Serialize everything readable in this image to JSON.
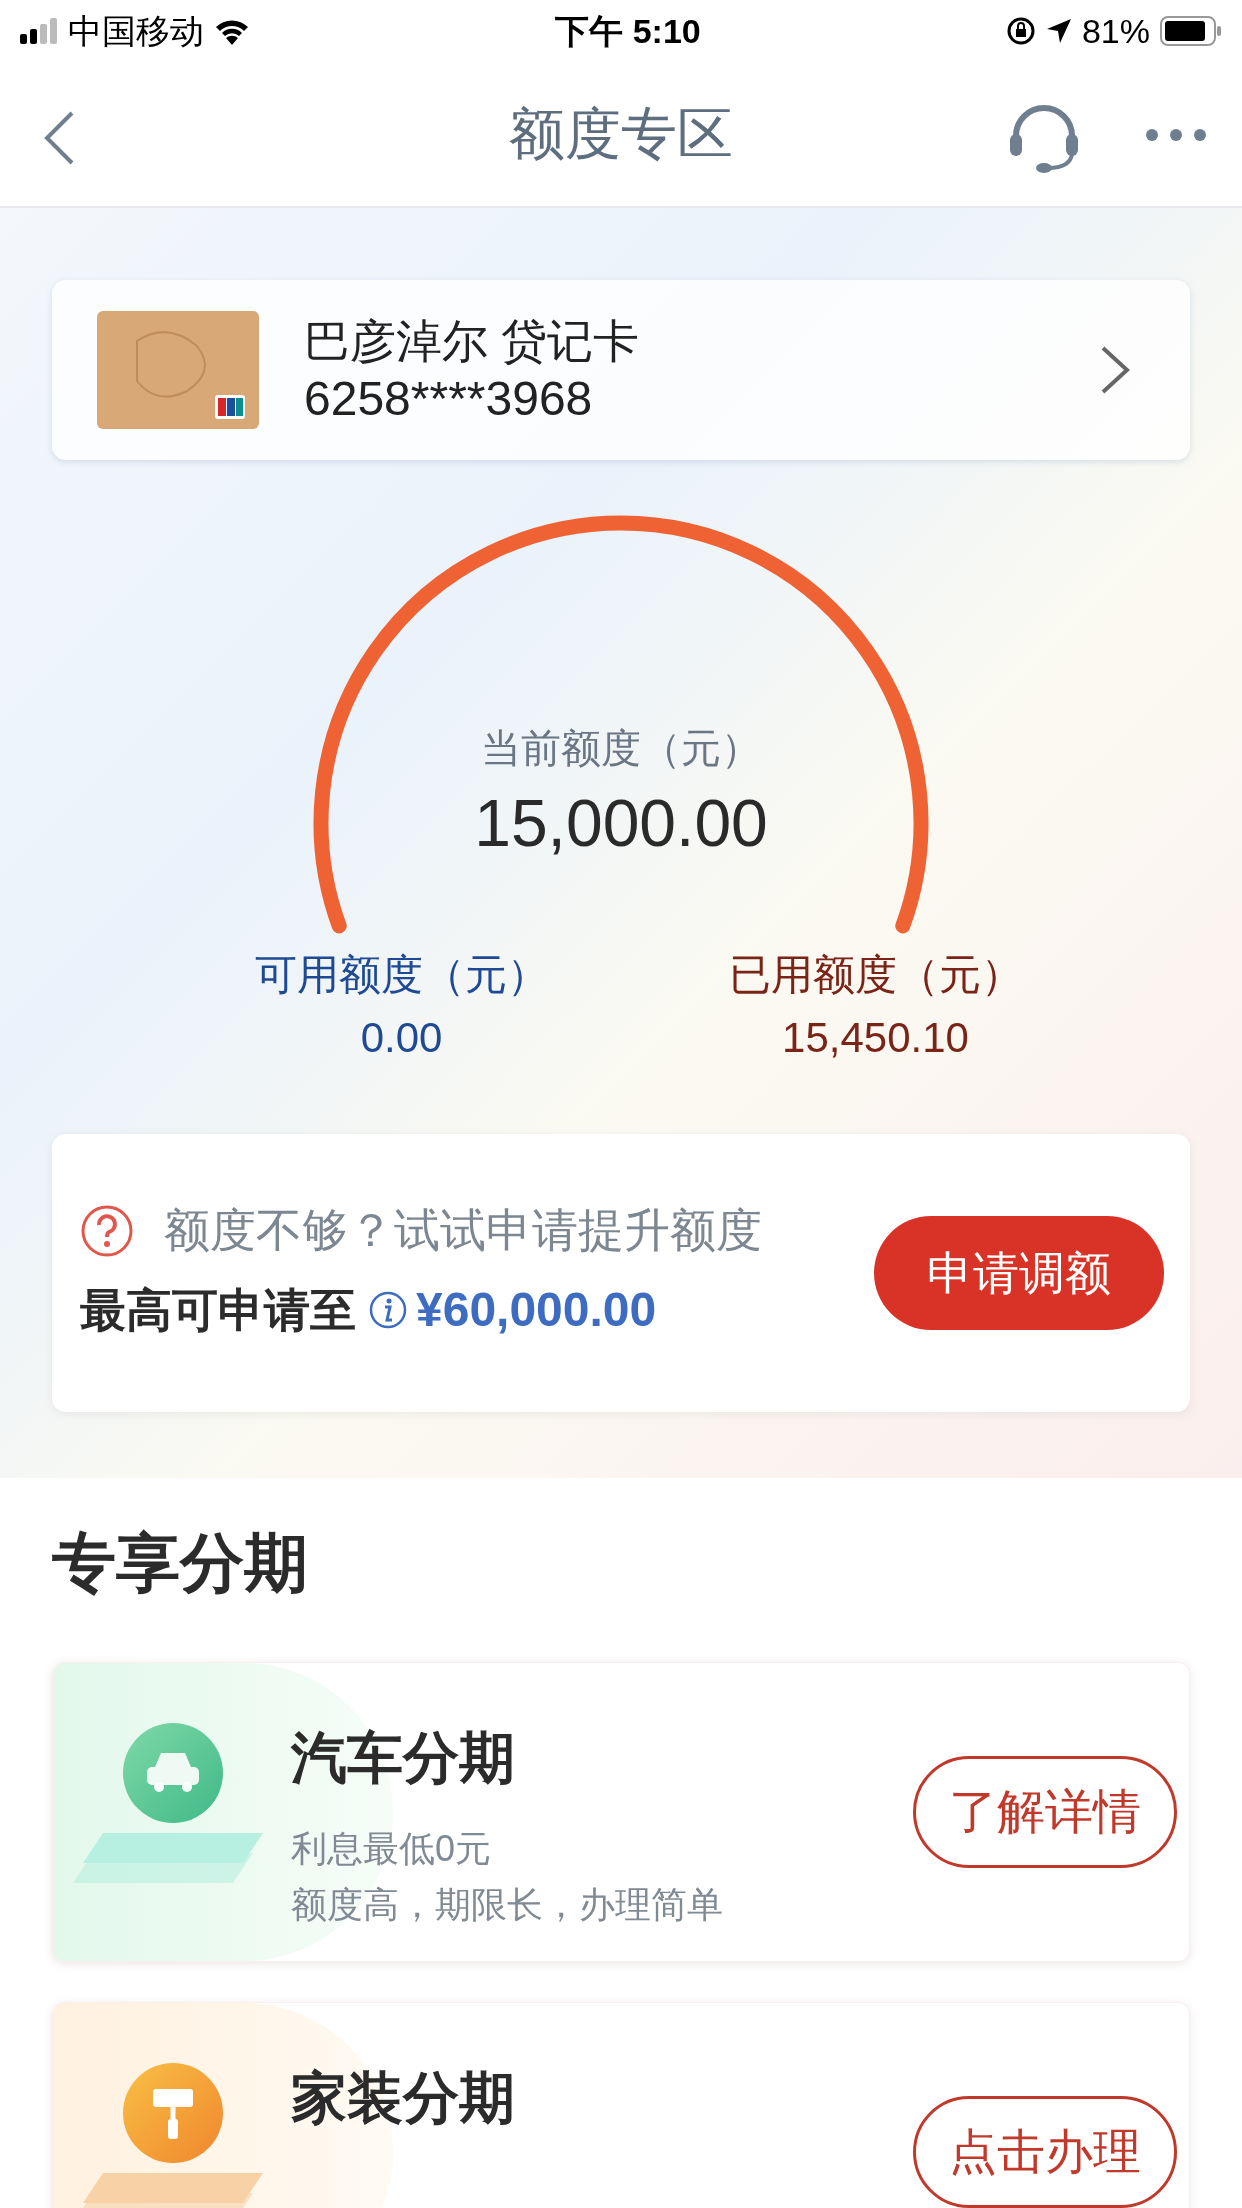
{
  "status_bar": {
    "carrier": "中国移动",
    "time": "下午 5:10",
    "battery": "81%"
  },
  "nav": {
    "title": "额度专区"
  },
  "bank_card": {
    "name": "巴彦淖尔 贷记卡",
    "number": "6258****3968"
  },
  "limit_gauge": {
    "label": "当前额度（元）",
    "amount": "15,000.00"
  },
  "available": {
    "label": "可用额度（元）",
    "amount": "0.00"
  },
  "used": {
    "label": "已用额度（元）",
    "amount": "15,450.10"
  },
  "raise_limit": {
    "prompt": "额度不够？试试申请提升额度",
    "max_label": "最高可申请至",
    "max_amount": "¥60,000.00",
    "button": "申请调额"
  },
  "section_title": "专享分期",
  "installments": [
    {
      "kind": "car",
      "title": "汽车分期",
      "lines": [
        "利息最低0元",
        "额度高，期限长，办理简单"
      ],
      "button": "了解详情"
    },
    {
      "kind": "home",
      "title": "家装分期",
      "button": "点击办理"
    }
  ]
}
